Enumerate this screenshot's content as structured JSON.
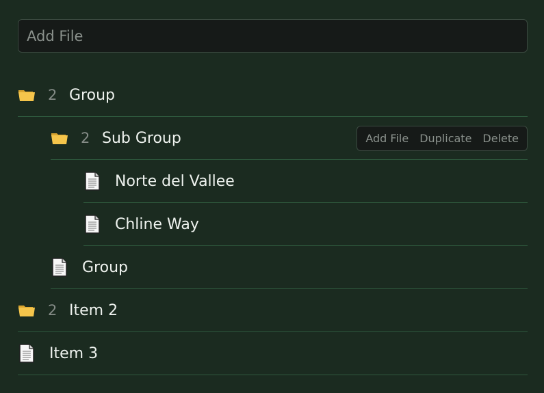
{
  "add_file_input": {
    "value": "",
    "placeholder": "Add File"
  },
  "tree": {
    "group": {
      "label": "Group",
      "count": "2",
      "icon": "folder-icon"
    },
    "sub_group": {
      "label": "Sub Group",
      "count": "2",
      "icon": "folder-icon"
    },
    "sub_group_actions": {
      "add_file": "Add File",
      "duplicate": "Duplicate",
      "delete": "Delete"
    },
    "file_norte": {
      "label": "Norte del Vallee",
      "icon": "file-icon"
    },
    "file_chline": {
      "label": "Chline Way",
      "icon": "file-icon"
    },
    "file_group": {
      "label": "Group",
      "icon": "file-icon"
    },
    "item2": {
      "label": "Item 2",
      "count": "2",
      "icon": "folder-icon"
    },
    "item3": {
      "label": "Item 3",
      "icon": "file-icon"
    }
  },
  "colors": {
    "background": "#1b2b20",
    "divider": "#2f5a3e",
    "folder": "#f5c54b",
    "text": "#eef2ee",
    "muted": "#858c87"
  }
}
